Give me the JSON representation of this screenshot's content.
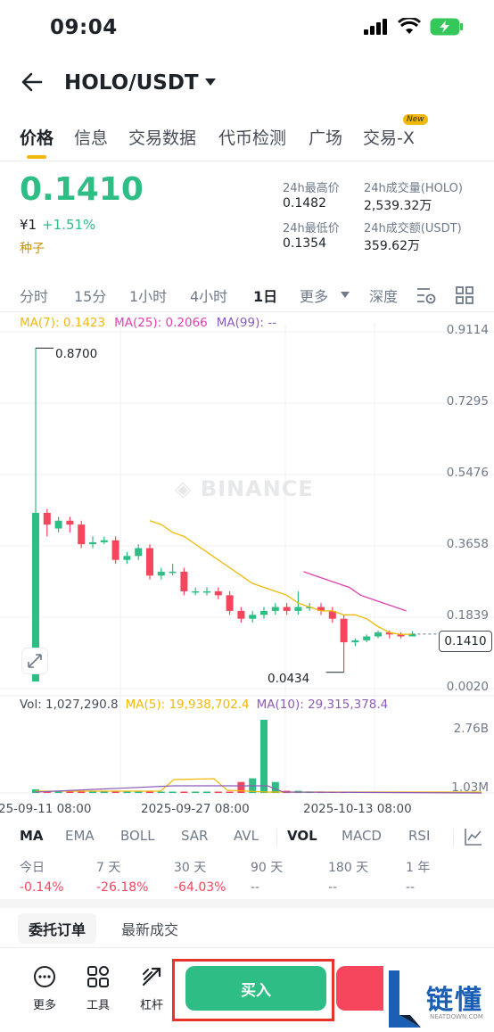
{
  "status": {
    "time": "09:04"
  },
  "nav": {
    "pair": "HOLO/USDT"
  },
  "tabs": [
    "价格",
    "信息",
    "交易数据",
    "代币检测",
    "广场",
    "交易-X"
  ],
  "new_badge": "New",
  "ticker": {
    "last_price": "0.1410",
    "fiat": "¥1",
    "change": "+1.51%",
    "tag": "种子",
    "high_label": "24h最高价",
    "high": "0.1482",
    "low_label": "24h最低价",
    "low": "0.1354",
    "vol_base_label": "24h成交量(HOLO)",
    "vol_base": "2,539.32万",
    "vol_quote_label": "24h成交额(USDT)",
    "vol_quote": "359.62万"
  },
  "intervals": [
    "分时",
    "15分",
    "1小时",
    "4小时",
    "1日",
    "更多",
    "深度"
  ],
  "ma": {
    "ma7": "MA(7): 0.1423",
    "ma25": "MA(25): 0.2066",
    "ma99": "MA(99): --"
  },
  "vol": {
    "vol": "Vol: 1,027,290.8",
    "ma5": "MA(5): 19,938,702.4",
    "ma10": "MA(10): 29,315,378.4"
  },
  "watermark": "BINANCE",
  "chart_data": {
    "type": "candlestick",
    "y_axis_ticks": [
      "0.9114",
      "0.7295",
      "0.5476",
      "0.3658",
      "0.1839",
      "0.0020"
    ],
    "ylim": [
      0.002,
      0.9114
    ],
    "high_marker": "0.8700",
    "low_marker": "0.0434",
    "current_price_tag": "0.1410",
    "x_ticks": [
      "25-09-11 08:00",
      "2025-09-27 08:00",
      "2025-10-13 08:00"
    ],
    "volume_ticks": [
      "2.76B",
      "1.03M"
    ],
    "candles": [
      {
        "o": 0.02,
        "c": 0.45,
        "h": 0.87,
        "l": 0.02
      },
      {
        "o": 0.45,
        "c": 0.42,
        "h": 0.46,
        "l": 0.39
      },
      {
        "o": 0.41,
        "c": 0.43,
        "h": 0.44,
        "l": 0.4
      },
      {
        "o": 0.43,
        "c": 0.42,
        "h": 0.44,
        "l": 0.4
      },
      {
        "o": 0.42,
        "c": 0.37,
        "h": 0.43,
        "l": 0.36
      },
      {
        "o": 0.37,
        "c": 0.375,
        "h": 0.39,
        "l": 0.36
      },
      {
        "o": 0.375,
        "c": 0.38,
        "h": 0.39,
        "l": 0.37
      },
      {
        "o": 0.38,
        "c": 0.33,
        "h": 0.39,
        "l": 0.32
      },
      {
        "o": 0.33,
        "c": 0.34,
        "h": 0.35,
        "l": 0.32
      },
      {
        "o": 0.34,
        "c": 0.36,
        "h": 0.37,
        "l": 0.33
      },
      {
        "o": 0.36,
        "c": 0.29,
        "h": 0.37,
        "l": 0.28
      },
      {
        "o": 0.29,
        "c": 0.3,
        "h": 0.31,
        "l": 0.28
      },
      {
        "o": 0.3,
        "c": 0.3,
        "h": 0.32,
        "l": 0.29
      },
      {
        "o": 0.3,
        "c": 0.25,
        "h": 0.31,
        "l": 0.24
      },
      {
        "o": 0.25,
        "c": 0.25,
        "h": 0.26,
        "l": 0.24
      },
      {
        "o": 0.25,
        "c": 0.25,
        "h": 0.26,
        "l": 0.24
      },
      {
        "o": 0.25,
        "c": 0.24,
        "h": 0.26,
        "l": 0.23
      },
      {
        "o": 0.24,
        "c": 0.2,
        "h": 0.25,
        "l": 0.19
      },
      {
        "o": 0.2,
        "c": 0.18,
        "h": 0.21,
        "l": 0.17
      },
      {
        "o": 0.18,
        "c": 0.19,
        "h": 0.2,
        "l": 0.17
      },
      {
        "o": 0.19,
        "c": 0.2,
        "h": 0.21,
        "l": 0.18
      },
      {
        "o": 0.2,
        "c": 0.21,
        "h": 0.22,
        "l": 0.19
      },
      {
        "o": 0.21,
        "c": 0.2,
        "h": 0.22,
        "l": 0.19
      },
      {
        "o": 0.2,
        "c": 0.21,
        "h": 0.25,
        "l": 0.19
      },
      {
        "o": 0.21,
        "c": 0.21,
        "h": 0.22,
        "l": 0.2
      },
      {
        "o": 0.21,
        "c": 0.2,
        "h": 0.22,
        "l": 0.19
      },
      {
        "o": 0.2,
        "c": 0.18,
        "h": 0.21,
        "l": 0.17
      },
      {
        "o": 0.18,
        "c": 0.12,
        "h": 0.19,
        "l": 0.0434
      },
      {
        "o": 0.12,
        "c": 0.125,
        "h": 0.13,
        "l": 0.11
      },
      {
        "o": 0.125,
        "c": 0.135,
        "h": 0.14,
        "l": 0.12
      },
      {
        "o": 0.135,
        "c": 0.145,
        "h": 0.15,
        "l": 0.13
      },
      {
        "o": 0.145,
        "c": 0.14,
        "h": 0.15,
        "l": 0.13
      },
      {
        "o": 0.14,
        "c": 0.135,
        "h": 0.145,
        "l": 0.13
      },
      {
        "o": 0.135,
        "c": 0.141,
        "h": 0.148,
        "l": 0.135
      }
    ],
    "ma7_line": [
      0.43,
      0.42,
      0.4,
      0.39,
      0.37,
      0.35,
      0.33,
      0.31,
      0.29,
      0.27,
      0.26,
      0.25,
      0.24,
      0.22,
      0.21,
      0.2,
      0.2,
      0.19,
      0.19,
      0.18,
      0.16,
      0.145,
      0.14,
      0.141
    ],
    "ma25_line": [
      0.3,
      0.29,
      0.28,
      0.27,
      0.26,
      0.24,
      0.23,
      0.22,
      0.21,
      0.2
    ],
    "volumes": [
      0.05,
      0.02,
      0.02,
      0.02,
      0.01,
      0.01,
      0.01,
      0.01,
      0.01,
      0.01,
      0.01,
      0.01,
      0.01,
      0.01,
      0.01,
      0.01,
      0.01,
      0.01,
      0.15,
      0.2,
      1.0,
      0.15,
      0.03,
      0.03,
      0.02,
      0.02,
      0.01,
      0.01,
      0.01,
      0.01,
      0.01,
      0.01,
      0.01,
      0.01
    ]
  },
  "indicators": [
    "MA",
    "EMA",
    "BOLL",
    "SAR",
    "AVL",
    "VOL",
    "MACD",
    "RSI"
  ],
  "performance": [
    {
      "label": "今日",
      "value": "-0.14%"
    },
    {
      "label": "7 天",
      "value": "-26.18%"
    },
    {
      "label": "30 天",
      "value": "-64.03%"
    },
    {
      "label": "90 天",
      "value": "--"
    },
    {
      "label": "180 天",
      "value": "--"
    },
    {
      "label": "1 年",
      "value": "--"
    }
  ],
  "order_tabs": [
    "委托订单",
    "最新成交"
  ],
  "bottom": {
    "more": "更多",
    "tools": "工具",
    "leverage": "杠杆",
    "buy": "买入"
  },
  "logo": {
    "text": "链懂",
    "sub": "NEATDOWN.COM"
  },
  "colors": {
    "up": "#2ebd85",
    "down": "#f6465d",
    "ma7": "#f0b90b",
    "ma25": "#e040b0",
    "ma99": "#8b5cb8"
  }
}
